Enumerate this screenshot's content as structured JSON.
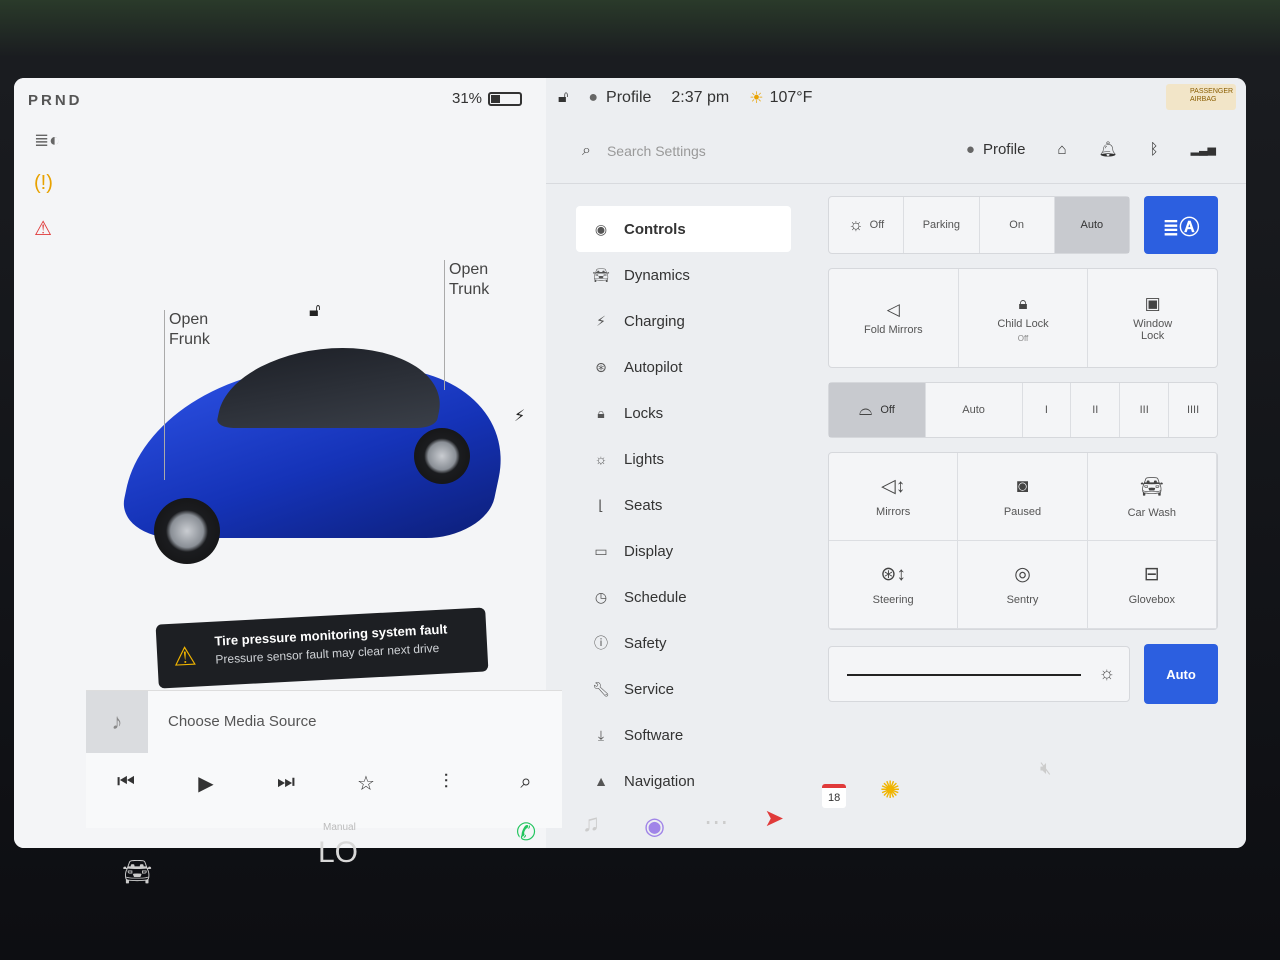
{
  "status": {
    "gear": "PRND",
    "battery_percent": "31%",
    "battery_level": 0.31
  },
  "car": {
    "frunk_label": "Open\nFrunk",
    "trunk_label": "Open\nTrunk",
    "body_color": "#1f44d6"
  },
  "alert": {
    "title": "Tire pressure monitoring system fault",
    "message": "Pressure sensor fault may clear next drive"
  },
  "media": {
    "source_label": "Choose Media Source"
  },
  "topbar": {
    "profile_label": "Profile",
    "time": "2:37 pm",
    "temperature": "107°F",
    "airbag_text": "PASSENGER AIRBAG"
  },
  "search": {
    "placeholder": "Search Settings",
    "profile_label": "Profile"
  },
  "nav": {
    "items": [
      {
        "label": "Controls",
        "icon": "toggle-icon"
      },
      {
        "label": "Dynamics",
        "icon": "car-icon"
      },
      {
        "label": "Charging",
        "icon": "bolt-icon"
      },
      {
        "label": "Autopilot",
        "icon": "steering-wheel-icon"
      },
      {
        "label": "Locks",
        "icon": "lock-icon"
      },
      {
        "label": "Lights",
        "icon": "light-icon"
      },
      {
        "label": "Seats",
        "icon": "seat-icon"
      },
      {
        "label": "Display",
        "icon": "display-icon"
      },
      {
        "label": "Schedule",
        "icon": "clock-icon"
      },
      {
        "label": "Safety",
        "icon": "info-icon"
      },
      {
        "label": "Service",
        "icon": "wrench-icon"
      },
      {
        "label": "Software",
        "icon": "download-icon"
      },
      {
        "label": "Navigation",
        "icon": "navigation-icon"
      }
    ]
  },
  "controls": {
    "lights": {
      "off": "Off",
      "parking": "Parking",
      "on": "On",
      "auto": "Auto"
    },
    "fold_mirrors": "Fold Mirrors",
    "child_lock": "Child Lock",
    "child_lock_state": "Off",
    "window_lock": "Window\nLock",
    "wipers": {
      "off": "Off",
      "auto": "Auto",
      "s1": "I",
      "s2": "II",
      "s3": "III",
      "s4": "IIII"
    },
    "mirrors": "Mirrors",
    "paused": "Paused",
    "car_wash": "Car Wash",
    "steering": "Steering",
    "sentry": "Sentry",
    "glovebox": "Glovebox",
    "brightness_auto": "Auto"
  },
  "dock": {
    "climate_mode": "Manual",
    "temperature": "LO",
    "calendar_day": "18"
  },
  "colors": {
    "accent_blue": "#2c5fe0",
    "warning_amber": "#f0b400",
    "alert_red": "#e03a3a"
  }
}
